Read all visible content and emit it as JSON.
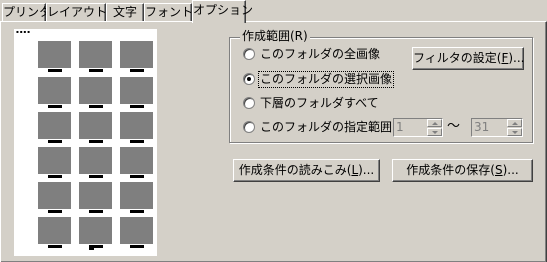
{
  "tabs": [
    {
      "label": "プリンタ",
      "active": false
    },
    {
      "label": "レイアウト",
      "active": false
    },
    {
      "label": "文字",
      "active": false
    },
    {
      "label": "フォント",
      "active": false
    },
    {
      "label": "オプション",
      "active": true
    }
  ],
  "preview": {
    "rows": 6,
    "cols": 3,
    "thumb_color": "#7f7f7f"
  },
  "range_group": {
    "label": "作成範囲(R)",
    "options": [
      {
        "label": "このフォルダの全画像",
        "checked": false
      },
      {
        "label": "このフォルダの選択画像",
        "checked": true
      },
      {
        "label": "下層のフォルダすべて",
        "checked": false
      },
      {
        "label": "このフォルダの指定範囲",
        "checked": false
      }
    ],
    "filter_button": {
      "label": "フィルタの設定(",
      "mnemonic": "F",
      "suffix": ")..."
    },
    "range_from": "1",
    "range_separator": "～",
    "range_to": "31"
  },
  "load_button": {
    "label": "作成条件の読みこみ(",
    "mnemonic": "L",
    "suffix": ")..."
  },
  "save_button": {
    "label": "作成条件の保存(",
    "mnemonic": "S",
    "suffix": ")..."
  },
  "colors": {
    "face": "#d4d0c8",
    "paper": "#ffffff",
    "disabled_text": "#808080"
  }
}
